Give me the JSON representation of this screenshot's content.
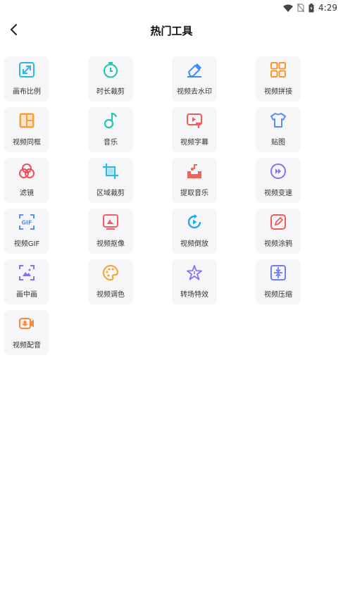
{
  "status_bar": {
    "time": "4:29"
  },
  "header": {
    "title": "热门工具"
  },
  "tools": [
    {
      "label": "画布比例"
    },
    {
      "label": "时长裁剪"
    },
    {
      "label": "视频去水印"
    },
    {
      "label": "视频拼接"
    },
    {
      "label": "视频同框"
    },
    {
      "label": "音乐"
    },
    {
      "label": "视频字幕"
    },
    {
      "label": "贴图"
    },
    {
      "label": "滤镜"
    },
    {
      "label": "区域裁剪"
    },
    {
      "label": "提取音乐"
    },
    {
      "label": "视频变速"
    },
    {
      "label": "视频GIF"
    },
    {
      "label": "视频抠像"
    },
    {
      "label": "视频倒放"
    },
    {
      "label": "视频涂鸦"
    },
    {
      "label": "画中画"
    },
    {
      "label": "视频调色"
    },
    {
      "label": "转场特效"
    },
    {
      "label": "视频压缩"
    },
    {
      "label": "视频配音"
    }
  ]
}
